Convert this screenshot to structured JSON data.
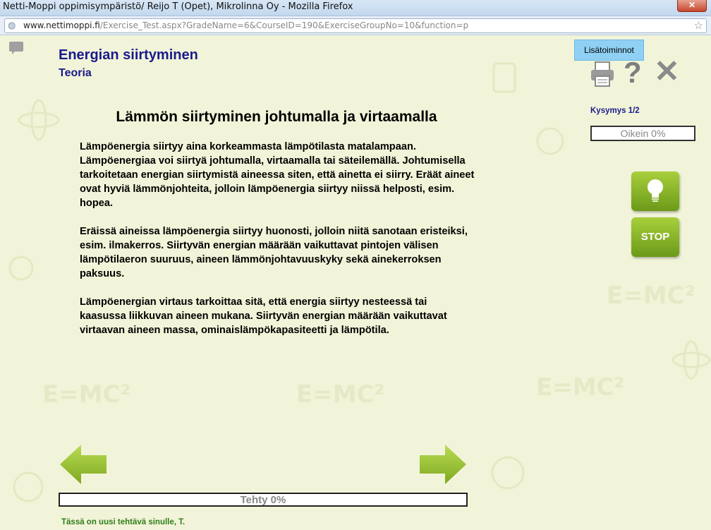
{
  "window": {
    "title": "Netti-Moppi oppimisympäristö/ Reijo T (Opet), Mikrolinna Oy - Mozilla Firefox",
    "close_label": "✕"
  },
  "address_bar": {
    "domain": "www.nettimoppi.fi",
    "path": "/Exercise_Test.aspx?GradeName=6&CourseID=190&ExerciseGroupNo=10&function=p"
  },
  "topic": {
    "title": "Energian siirtyminen",
    "subtitle": "Teoria"
  },
  "lesson": {
    "heading": "Lämmön siirtyminen johtumalla ja virtaamalla",
    "paragraphs": [
      "Lämpöenergia siirtyy aina korkeammasta lämpötilasta matalampaan. Lämpöenergiaa voi siirtyä johtumalla, virtaamalla tai säteilemällä. Johtumisella tarkoitetaan energian siirtymistä aineessa siten, että ainetta ei siirry. Eräät aineet ovat hyviä lämmönjohteita, jolloin lämpöenergia siirtyy niissä helposti, esim. hopea.",
      "Eräissä aineissa lämpöenergia siirtyy huonosti, jolloin niitä sanotaan eristeiksi, esim. ilmakerros. Siirtyvän energian määrään vaikuttavat pintojen välisen lämpötilaeron suuruus, aineen lämmönjohtavuuskyky sekä ainekerroksen paksuus.",
      "Lämpöenergian virtaus tarkoittaa sitä, että energia siirtyy nesteessä tai kaasussa liikkuvan aineen mukana. Siirtyvän energian määrään vaikuttavat virtaavan aineen massa, ominaislämpökapasiteetti ja lämpötila."
    ]
  },
  "toolbar": {
    "extra_label": "Lisätoiminnot",
    "icons": [
      "print-icon",
      "help-icon",
      "close-icon",
      "comment-icon"
    ]
  },
  "status": {
    "question_counter": "Kysymys 1/2",
    "correct_label": "Oikein 0%",
    "done_label": "Tehty 0%"
  },
  "buttons": {
    "hint_icon": "lightbulb-icon",
    "stop_label": "STOP",
    "prev_icon": "arrow-left-icon",
    "next_icon": "arrow-right-icon"
  },
  "footer": {
    "message": "Tässä on uusi tehtävä sinulle, T."
  },
  "colors": {
    "background": "#f2f4d9",
    "heading_blue": "#1a1a8c",
    "button_green": "#8bbd2a",
    "accent_blue": "#8fd0f4",
    "footer_green": "#2f7d1a"
  }
}
